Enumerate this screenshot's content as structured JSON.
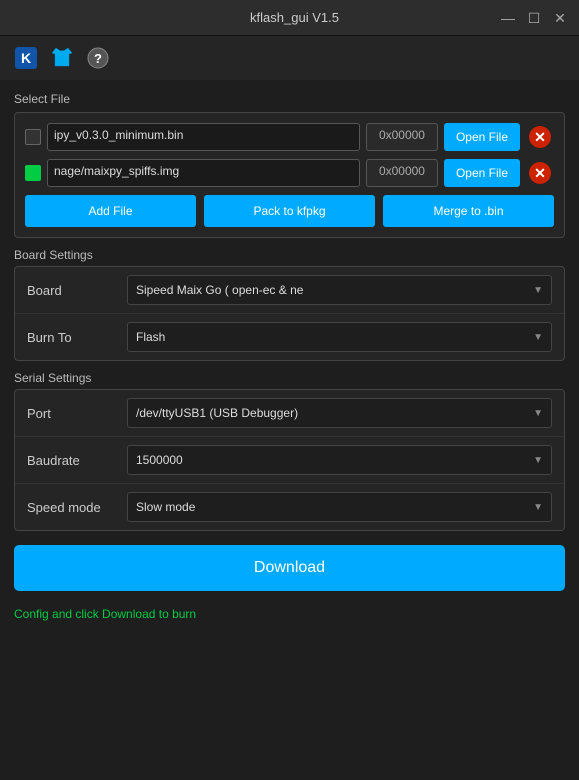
{
  "window": {
    "title": "kflash_gui V1.5",
    "minimize_label": "—",
    "maximize_label": "☐",
    "close_label": "✕"
  },
  "toolbar": {
    "logo_icon": "🔖",
    "shirt_icon": "👕",
    "help_icon": "❓"
  },
  "file_section": {
    "label": "Select File",
    "files": [
      {
        "checked": false,
        "filename": "ipy_v0.3.0_minimum.bin",
        "address": "0x00000",
        "open_label": "Open File"
      },
      {
        "checked": true,
        "filename": "nage/maixpy_spiffs.img",
        "address": "0x00000",
        "open_label": "Open File"
      }
    ],
    "add_file_label": "Add File",
    "pack_label": "Pack to kfpkg",
    "merge_label": "Merge to .bin"
  },
  "board_settings": {
    "label": "Board Settings",
    "rows": [
      {
        "key": "Board",
        "value": "Sipeed Maix Go ( open-ec & ne"
      },
      {
        "key": "Burn To",
        "value": "Flash"
      }
    ]
  },
  "serial_settings": {
    "label": "Serial Settings",
    "rows": [
      {
        "key": "Port",
        "value": "/dev/ttyUSB1 (USB Debugger)"
      },
      {
        "key": "Baudrate",
        "value": "1500000"
      },
      {
        "key": "Speed mode",
        "value": "Slow mode"
      }
    ]
  },
  "download": {
    "label": "Download"
  },
  "status": {
    "text": "Config and click Download to burn"
  }
}
